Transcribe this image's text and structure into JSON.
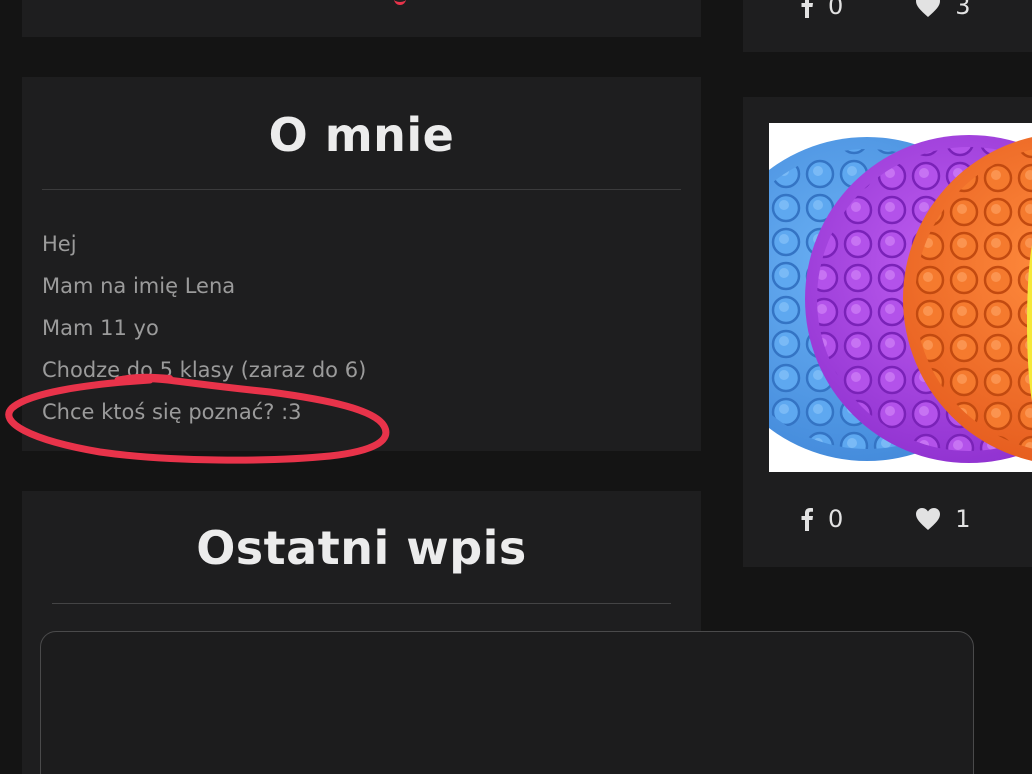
{
  "about": {
    "title": "O mnie",
    "lines": [
      "Hej",
      "Mam na imię Lena",
      "Mam 11 yo",
      "Chodze do 5 klasy (zaraz do 6)",
      "Chce ktoś się poznać? :3"
    ]
  },
  "latest_post": {
    "title": "Ostatni wpis"
  },
  "posts": [
    {
      "facebook_count": "0",
      "likes_count": "3"
    },
    {
      "facebook_count": "0",
      "likes_count": "1",
      "image_alt": "pop-it toys"
    }
  ],
  "icons": {
    "facebook": "facebook-icon",
    "heart": "heart-icon"
  },
  "colors": {
    "background": "#141414",
    "panel": "#1e1e1f",
    "title_text": "#ececec",
    "body_text": "#9b9b9b",
    "annotation_red": "#e8334a",
    "popit_blue": "#4f9be8",
    "popit_purple": "#a83fe0",
    "popit_orange": "#f06a22"
  }
}
